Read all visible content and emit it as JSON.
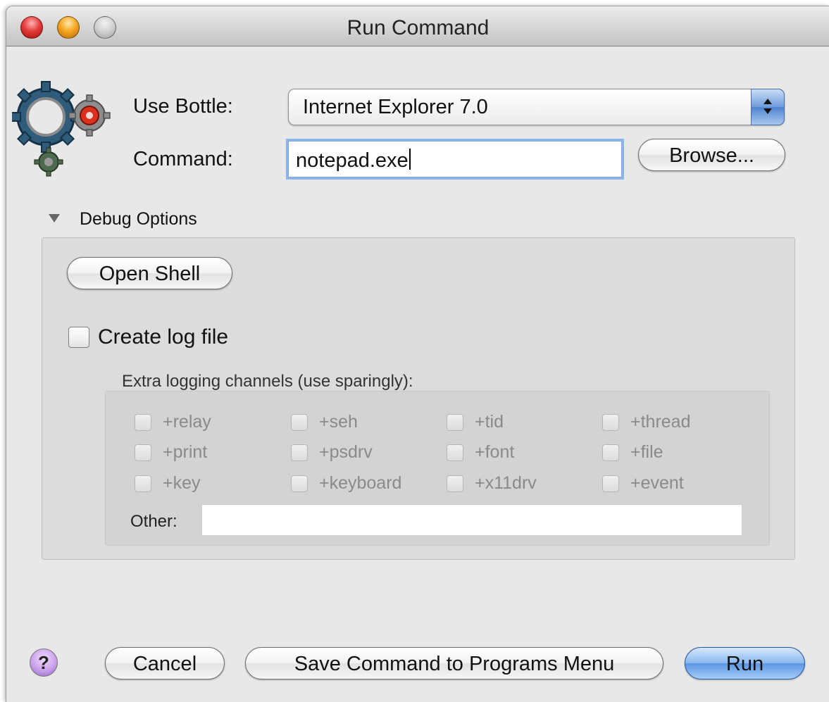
{
  "window": {
    "title": "Run Command"
  },
  "bottle": {
    "label": "Use Bottle:",
    "selected": "Internet Explorer 7.0"
  },
  "command": {
    "label": "Command:",
    "value": "notepad.exe",
    "browse_label": "Browse..."
  },
  "debug": {
    "disclosure_label": "Debug Options",
    "open_shell_label": "Open Shell",
    "create_log_label": "Create log file",
    "create_log_checked": false,
    "channels_label": "Extra logging channels (use sparingly):",
    "channels": [
      [
        "+relay",
        "+seh",
        "+tid",
        "+thread"
      ],
      [
        "+print",
        "+psdrv",
        "+font",
        "+file"
      ],
      [
        "+key",
        "+keyboard",
        "+x11drv",
        "+event"
      ]
    ],
    "other_label": "Other:",
    "other_value": ""
  },
  "footer": {
    "help_label": "?",
    "cancel_label": "Cancel",
    "save_label": "Save Command to Programs Menu",
    "run_label": "Run"
  },
  "colors": {
    "window_bg": "#e8e8e8",
    "primary_button": "#5b95e3",
    "focus_ring": "#8cb4ec"
  },
  "icons": [
    "gears-icon",
    "close-icon",
    "minimize-icon",
    "zoom-icon",
    "popup-arrows-icon",
    "disclosure-triangle-icon",
    "help-icon"
  ]
}
